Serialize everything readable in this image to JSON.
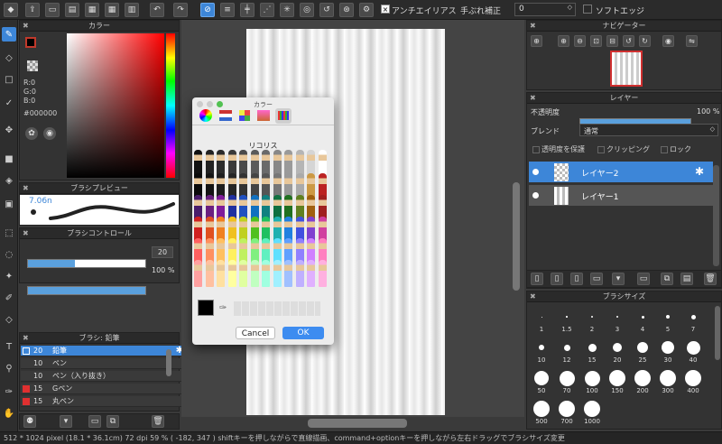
{
  "toolbar": {
    "antialias_label": "アンチエイリアス",
    "stabilizer_label": "手ぶれ補正",
    "stabilizer_value": "0",
    "soft_edge_label": "ソフトエッジ",
    "antialias_mark": "×",
    "mark_chevrons": "◇"
  },
  "color_panel": {
    "title": "カラー",
    "r": "R:0",
    "g": "G:0",
    "b": "B:0",
    "hex": "#000000"
  },
  "brush_preview": {
    "title": "ブラシプレビュー",
    "size": "7.06n"
  },
  "brush_control": {
    "title": "ブラシコントロール",
    "size_value": "20",
    "opacity_value": "100 %",
    "size_fraction": 0.4,
    "opacity_fraction": 1.0
  },
  "brush_list": {
    "title": "ブラシ: 鉛筆",
    "items": [
      {
        "size": "20",
        "name": "鉛筆",
        "color": "#3d86d8"
      },
      {
        "size": "10",
        "name": "ペン",
        "color": "#3a3a3a"
      },
      {
        "size": "10",
        "name": "ペン（入り抜き）",
        "color": "#3a3a3a"
      },
      {
        "size": "15",
        "name": "Gペン",
        "color": "#e03030"
      },
      {
        "size": "15",
        "name": "丸ペン",
        "color": "#e03030"
      }
    ]
  },
  "navigator": {
    "title": "ナビゲーター"
  },
  "layers": {
    "title": "レイヤー",
    "opacity_label": "不透明度",
    "opacity_value": "100 %",
    "opacity_fraction": 1.0,
    "blend_label": "ブレンド",
    "blend_value": "通常",
    "protect_label": "透明度を保護",
    "clipping_label": "クリッピング",
    "lock_label": "ロック",
    "items": [
      "レイヤー2",
      "レイヤー1"
    ]
  },
  "brush_size": {
    "title": "ブラシサイズ",
    "sizes": [
      "1",
      "1.5",
      "2",
      "3",
      "4",
      "5",
      "7",
      "10",
      "12",
      "15",
      "20",
      "25",
      "30",
      "40",
      "50",
      "70",
      "100",
      "150",
      "200",
      "300",
      "400",
      "500",
      "700",
      "1000"
    ]
  },
  "color_dialog": {
    "title": "カラー",
    "selected_name": "リコリス",
    "cancel": "Cancel",
    "ok": "OK"
  },
  "status": {
    "text": "512 * 1024 pixel   (18.1 * 36.1cm)   72 dpi   59 %   ( -182, 347 )   shiftキーを押しながらで直線描画、command+optionキーを押しながら左右ドラッグでブラシサイズ変更"
  }
}
